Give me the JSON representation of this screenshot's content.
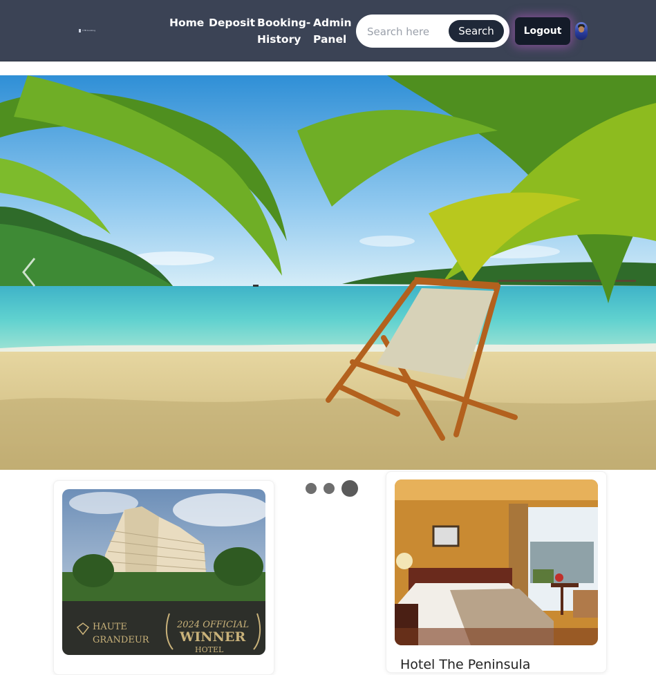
{
  "navbar": {
    "logo_text": "CTB booking",
    "links": [
      {
        "label": "Home"
      },
      {
        "label": "Deposit"
      },
      {
        "label": "Booking-History"
      },
      {
        "label": "Admin Panel"
      }
    ],
    "search": {
      "placeholder": "Search here",
      "value": "",
      "button_label": "Search"
    },
    "logout_label": "Logout",
    "accent_color": "#3b4355"
  },
  "hero": {
    "icon": "chevron-left-icon"
  },
  "carousel": {
    "slide_count": 3,
    "active_index": 2
  },
  "cards": [
    {
      "image_text_brand_top": "HAUTE",
      "image_text_brand_bottom": "GRANDEUR",
      "image_text_year": "2024 OFFICIAL",
      "image_text_winner": "WINNER",
      "image_text_hotel": "HOTEL"
    },
    {
      "title": "Hotel The Peninsula"
    }
  ]
}
